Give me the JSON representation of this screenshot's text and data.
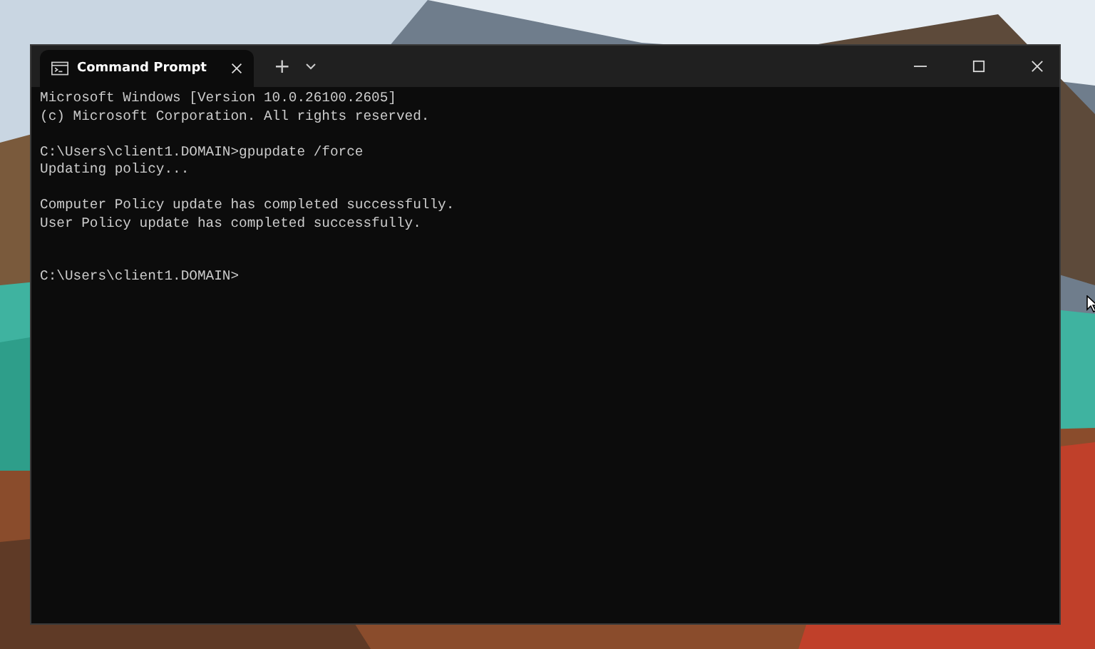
{
  "window": {
    "tabs": [
      {
        "title": "Command Prompt",
        "selected": true
      }
    ],
    "new_tab": "+"
  },
  "terminal": {
    "blocks": [
      [
        "Microsoft Windows [Version 10.0.26100.2605]",
        "(c) Microsoft Corporation. All rights reserved."
      ],
      [
        "C:\\Users\\client1.DOMAIN>gpupdate /force",
        "Updating policy..."
      ],
      [
        "Computer Policy update has completed successfully.",
        "User Policy update has completed successfully."
      ]
    ],
    "prompt": "C:\\Users\\client1.DOMAIN>"
  }
}
